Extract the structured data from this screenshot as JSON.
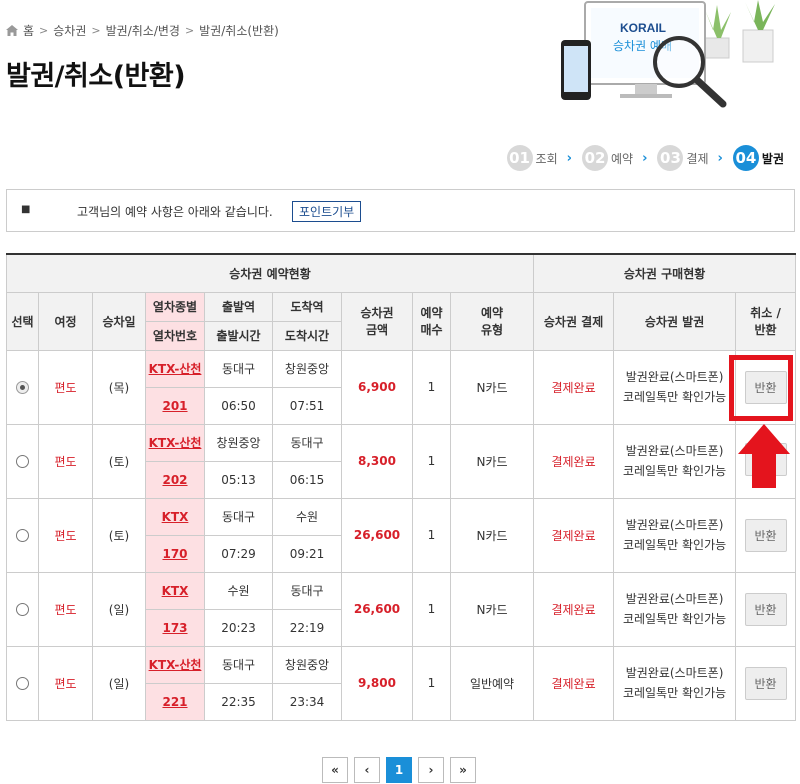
{
  "breadcrumb": [
    "홈",
    "승차권",
    "발권/취소/변경",
    "발권/취소(반환)"
  ],
  "page_title": "발권/취소(반환)",
  "hero": {
    "logo": "KORAIL",
    "screen_text": "승차권 예매"
  },
  "steps": [
    {
      "num": "01",
      "label": "조회",
      "active": false
    },
    {
      "num": "02",
      "label": "예약",
      "active": false
    },
    {
      "num": "03",
      "label": "결제",
      "active": false
    },
    {
      "num": "04",
      "label": "발권",
      "active": true
    }
  ],
  "info": {
    "text": "고객님의 예약 사항은 아래와 같습니다.",
    "button": "포인트기부"
  },
  "table": {
    "group_left": "승차권 예약현황",
    "group_right": "승차권 구매현황",
    "headers": {
      "select": "선택",
      "trip": "여정",
      "date": "승차일",
      "train_type": "열차종별",
      "train_no": "열차번호",
      "dep_station": "출발역",
      "dep_time": "출발시간",
      "arr_station": "도착역",
      "arr_time": "도착시간",
      "fare": "승차권\n금액",
      "count": "예약\n매수",
      "res_type": "예약\n유형",
      "payment": "승차권 결제",
      "issue": "승차권 발권",
      "cancel": "취소 /\n반환"
    },
    "rows": [
      {
        "selected": true,
        "trip": "편도",
        "date": "(목)",
        "train": "KTX-산천",
        "no": "201",
        "dep": "동대구",
        "dep_time": "06:50",
        "arr": "창원중앙",
        "arr_time": "07:51",
        "fare": "6,900",
        "count": "1",
        "type": "N카드",
        "payment": "결제완료",
        "issue1": "발권완료(스마트폰)",
        "issue2": "코레일톡만 확인가능",
        "btn": "반환"
      },
      {
        "selected": false,
        "trip": "편도",
        "date": "(토)",
        "train": "KTX-산천",
        "no": "202",
        "dep": "창원중앙",
        "dep_time": "05:13",
        "arr": "동대구",
        "arr_time": "06:15",
        "fare": "8,300",
        "count": "1",
        "type": "N카드",
        "payment": "결제완료",
        "issue1": "발권완료(스마트폰)",
        "issue2": "코레일톡만 확인가능",
        "btn": ""
      },
      {
        "selected": false,
        "trip": "편도",
        "date": "(토)",
        "train": "KTX",
        "no": "170",
        "dep": "동대구",
        "dep_time": "07:29",
        "arr": "수원",
        "arr_time": "09:21",
        "fare": "26,600",
        "count": "1",
        "type": "N카드",
        "payment": "결제완료",
        "issue1": "발권완료(스마트폰)",
        "issue2": "코레일톡만 확인가능",
        "btn": "반환"
      },
      {
        "selected": false,
        "trip": "편도",
        "date": "(일)",
        "train": "KTX",
        "no": "173",
        "dep": "수원",
        "dep_time": "20:23",
        "arr": "동대구",
        "arr_time": "22:19",
        "fare": "26,600",
        "count": "1",
        "type": "N카드",
        "payment": "결제완료",
        "issue1": "발권완료(스마트폰)",
        "issue2": "코레일톡만 확인가능",
        "btn": "반환"
      },
      {
        "selected": false,
        "trip": "편도",
        "date": "(일)",
        "train": "KTX-산천",
        "no": "221",
        "dep": "동대구",
        "dep_time": "22:35",
        "arr": "창원중앙",
        "arr_time": "23:34",
        "fare": "9,800",
        "count": "1",
        "type": "일반예약",
        "payment": "결제완료",
        "issue1": "발권완료(스마트폰)",
        "issue2": "코레일톡만 확인가능",
        "btn": "반환"
      }
    ]
  },
  "pager": {
    "first": "«",
    "prev": "‹",
    "current": "1",
    "next": "›",
    "last": "»"
  },
  "colors": {
    "accent_blue": "#1a8fd8",
    "alert_red": "#e4141d",
    "train_pink": "#fde0e3"
  }
}
